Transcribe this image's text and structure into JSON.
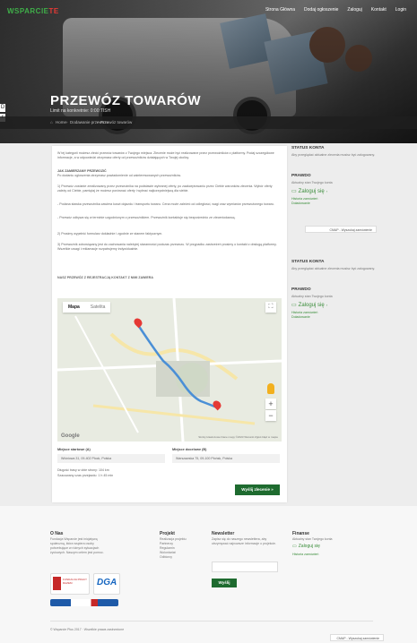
{
  "header": {
    "logo": {
      "main": "WSPARCIE",
      "accent": "TE"
    },
    "nav": [
      "Strona Główna",
      "Dodaj ogłoszenie",
      "Zaloguj",
      "Kontakt",
      "Login"
    ],
    "title": "PRZEWÓZ TOWARÓW",
    "subtitle": "Limit na konkretnie: 0:00:TISH"
  },
  "side_tabs": [
    "D",
    "r"
  ],
  "breadcrumb": {
    "items": [
      "Home",
      "Dodawanie przewozu",
      "Przewóz towarów"
    ]
  },
  "content": {
    "paragraphs": [
      "W tej kategorii możesz zlecić przewóz towarów z Twojego miejsca. Zlecenie może być realizowane przez przewoźników z platformy. Podaj szczegółowe informacje, a w odpowiedzi otrzymasz oferty od przewoźników działających w Twojej okolicy.",
      "JAK ZAMIERZAMY PRZEWOZIĆ",
      "Po dodaniu ogłoszenia otrzymasz powiadomienie od zainteresowanych przewoźników.",
      "1) Przewóz zostanie zrealizowany przez przewoźnika na podstawie wybranej oferty, po zaakceptowaniu przez Ciebie warunków zlecenia. Wybór oferty zależy od Ciebie, pamiętaj że możesz porównać oferty i wybrać najkorzystniejszą dla siebie.",
      "- Podana stawka przewoźnika zawiera koszt dojazdu i transportu towaru. Cena może zależeć od odległości, wagi oraz wymiarów przewożonego towaru.",
      "- Przewóz odbywa się w terminie uzgodnionym z przewoźnikiem. Przewoźnik kontaktuje się bezpośrednio ze zleceniodawcą.",
      "2) Prosimy wypełnić formularz dokładnie i zgodnie ze stanem faktycznym.",
      "3) Przewoźnik zobowiązany jest do zachowania należytej staranności podczas przewozu. W przypadku zastrzeżeń prosimy o kontakt z obsługą platformy. Wszelkie uwagi i reklamacje rozpatrujemy indywidualnie.",
      "NASZ PRZEWÓZ Z REJESTRACJĄ KONTAKT Z NIMI ZAWIERA"
    ],
    "map": {
      "tab_map": "Mapa",
      "tab_sat": "Satelita",
      "fullscreen_icon": "fullscreen-icon",
      "zoom_in": "+",
      "zoom_out": "−",
      "google_label": "Google",
      "footer_text": "Skróty klawiszowe  Dane mapy ©2023  Warunki  Zgłoś błąd w mapie"
    },
    "from_label": "Miejsce startowe (A)",
    "from_value": "Wiśniowa 31, 09-402 Płock, Polska",
    "to_label": "Miejsce docelowe (B)",
    "to_value": "Warszawska 75, 09-100 Płońsk, Polska",
    "distance_text": "Długość trasy w obie strony: 104 km",
    "time_text": "Szacowany czas przejazdu: 1 h 45 min",
    "submit_label": "Wyślij zlecenie »"
  },
  "sidebar": {
    "blocks": [
      {
        "status_title": "STATUS KONTA",
        "status_text": "Aby przeglądać aktualne zlecenia musisz być zalogowany.",
        "login_title": "PRAWDO",
        "login_text": "Aktualny stan Twojego konta",
        "login_label": "Zaloguj się",
        "link1": "Historia zamówień",
        "link2": "Doładowanie",
        "select": "CMAP - Wyszukaj zamówienie"
      },
      {
        "status_title": "STATUS KONTA",
        "status_text": "Aby przeglądać aktualne zlecenia musisz być zalogowany.",
        "login_title": "PRAWDO",
        "login_text": "Aktualny stan Twojego konta",
        "login_label": "Zaloguj się",
        "link1": "Historia zamówień",
        "link2": "Doładowanie",
        "select": "CMAP - Wyszukaj zamówienie"
      }
    ]
  },
  "footer": {
    "about_title": "O Nas",
    "about_text": "Fundacja Wsparcie jest inicjatywą społeczną, która wspiera osoby potrzebujące w różnych sytuacjach życiowych. Naszym celem jest pomoc.",
    "badge1": "FUNDACJA PRACY RAZEM",
    "badge2": "DGA",
    "projects_title": "Projekt",
    "projects": [
      "Realizacja projektu",
      "Partnerzy",
      "Regulamin",
      "Wolontariat",
      "Odbiorcy"
    ],
    "newsletter_title": "Newsletter",
    "newsletter_text": "Zapisz się do naszego newslettera, aby otrzymywać najnowsze informacje o projekcie.",
    "newsletter_button": "Wyślij",
    "account_title": "Finanse",
    "account_text": "Aktualny stan Twojego konta",
    "account_login": "Zaloguj się",
    "account_link": "Historia zamówień",
    "copyright": "© Wsparcie Plus 2017 · Wszelkie prawa zastrzeżone",
    "bottom_select": "CMAP - Wyszukaj zamówienie"
  },
  "colors": {
    "accent": "#1e6b2f",
    "link": "#3a8d3a",
    "pin": "#e53935",
    "route": "#4a8fd6"
  }
}
